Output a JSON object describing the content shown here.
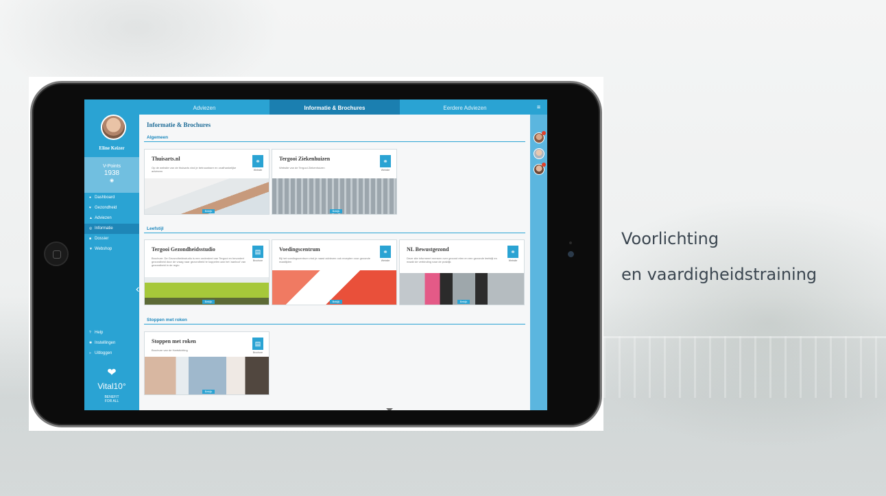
{
  "slide": {
    "tagline_line1": "Voorlichting",
    "tagline_line2": "en vaardigheidstraining"
  },
  "app": {
    "user_name": "Eline Keizer",
    "vpoints_label": "V-Points",
    "vpoints_value": "1938",
    "nav": [
      {
        "label": "Dashboard",
        "icon": "dashboard-icon",
        "glyph": "●"
      },
      {
        "label": "Gezondheid",
        "icon": "heart-icon",
        "glyph": "♥"
      },
      {
        "label": "Adviezen",
        "icon": "advice-icon",
        "glyph": "▲"
      },
      {
        "label": "Informatie",
        "icon": "info-icon",
        "glyph": "◎"
      },
      {
        "label": "Dossier",
        "icon": "dossier-icon",
        "glyph": "■"
      },
      {
        "label": "Webshop",
        "icon": "cart-icon",
        "glyph": "▼"
      }
    ],
    "nav_bottom": [
      {
        "label": "Help",
        "icon": "help-icon",
        "glyph": "?"
      },
      {
        "label": "Instellingen",
        "icon": "settings-icon",
        "glyph": "✱"
      },
      {
        "label": "Uitloggen",
        "icon": "logout-icon",
        "glyph": "»"
      }
    ],
    "logo_text": "Vital10°",
    "logo_sub1": "BENEFIT",
    "logo_sub2": "FOR ALL",
    "tabs": [
      "Adviezen",
      "Informatie & Brochures",
      "Eerdere Adviezen"
    ],
    "page_title": "Informatie & Brochures",
    "sections": [
      {
        "title": "Algemeen",
        "cards": [
          {
            "title": "Thuisarts.nl",
            "desc": "Op de website van de thuisarts vind je betrouwbare en onafhankelijke adviezen",
            "icon": "link-icon",
            "icon_label": "Website",
            "button": "Bekijk"
          },
          {
            "title": "Tergooi Ziekenhuizen",
            "desc": "Website van de Tergooi Ziekenhuizen",
            "icon": "link-icon",
            "icon_label": "Website",
            "button": "Bekijk"
          }
        ]
      },
      {
        "title": "Leefstijl",
        "cards": [
          {
            "title": "Tergooi Gezondheidsstudio",
            "desc": "Brochure: De Gezondheidsstudio is een onderdeel van Tergooi en bevordert gezondheid door de vraag naar gezondheid te koppelen aan het 'aanbod' van gezondheid in de regio",
            "icon": "brochure-icon",
            "icon_label": "Brochure",
            "button": "Bekijk"
          },
          {
            "title": "Voedingscentrum",
            "desc": "Bij het voedingscentrum vind je naast adviezen ook recepten voor gezonde maaltijden",
            "icon": "link-icon",
            "icon_label": "Website",
            "button": "Bekijk"
          },
          {
            "title": "NL Bewustgezond",
            "desc": "Deze site informeert mensen over gezond eten en een gezonde leefstijl en maakt de verbinding naar de praktijk",
            "icon": "link-icon",
            "icon_label": "Website",
            "button": "Bekijk"
          }
        ]
      },
      {
        "title": "Stoppen met roken",
        "cards": [
          {
            "title": "Stoppen met roken",
            "desc": "Brochure van de Hartstichting",
            "icon": "brochure-icon",
            "icon_label": "Brochure",
            "button": "Bekijk"
          }
        ]
      }
    ]
  }
}
